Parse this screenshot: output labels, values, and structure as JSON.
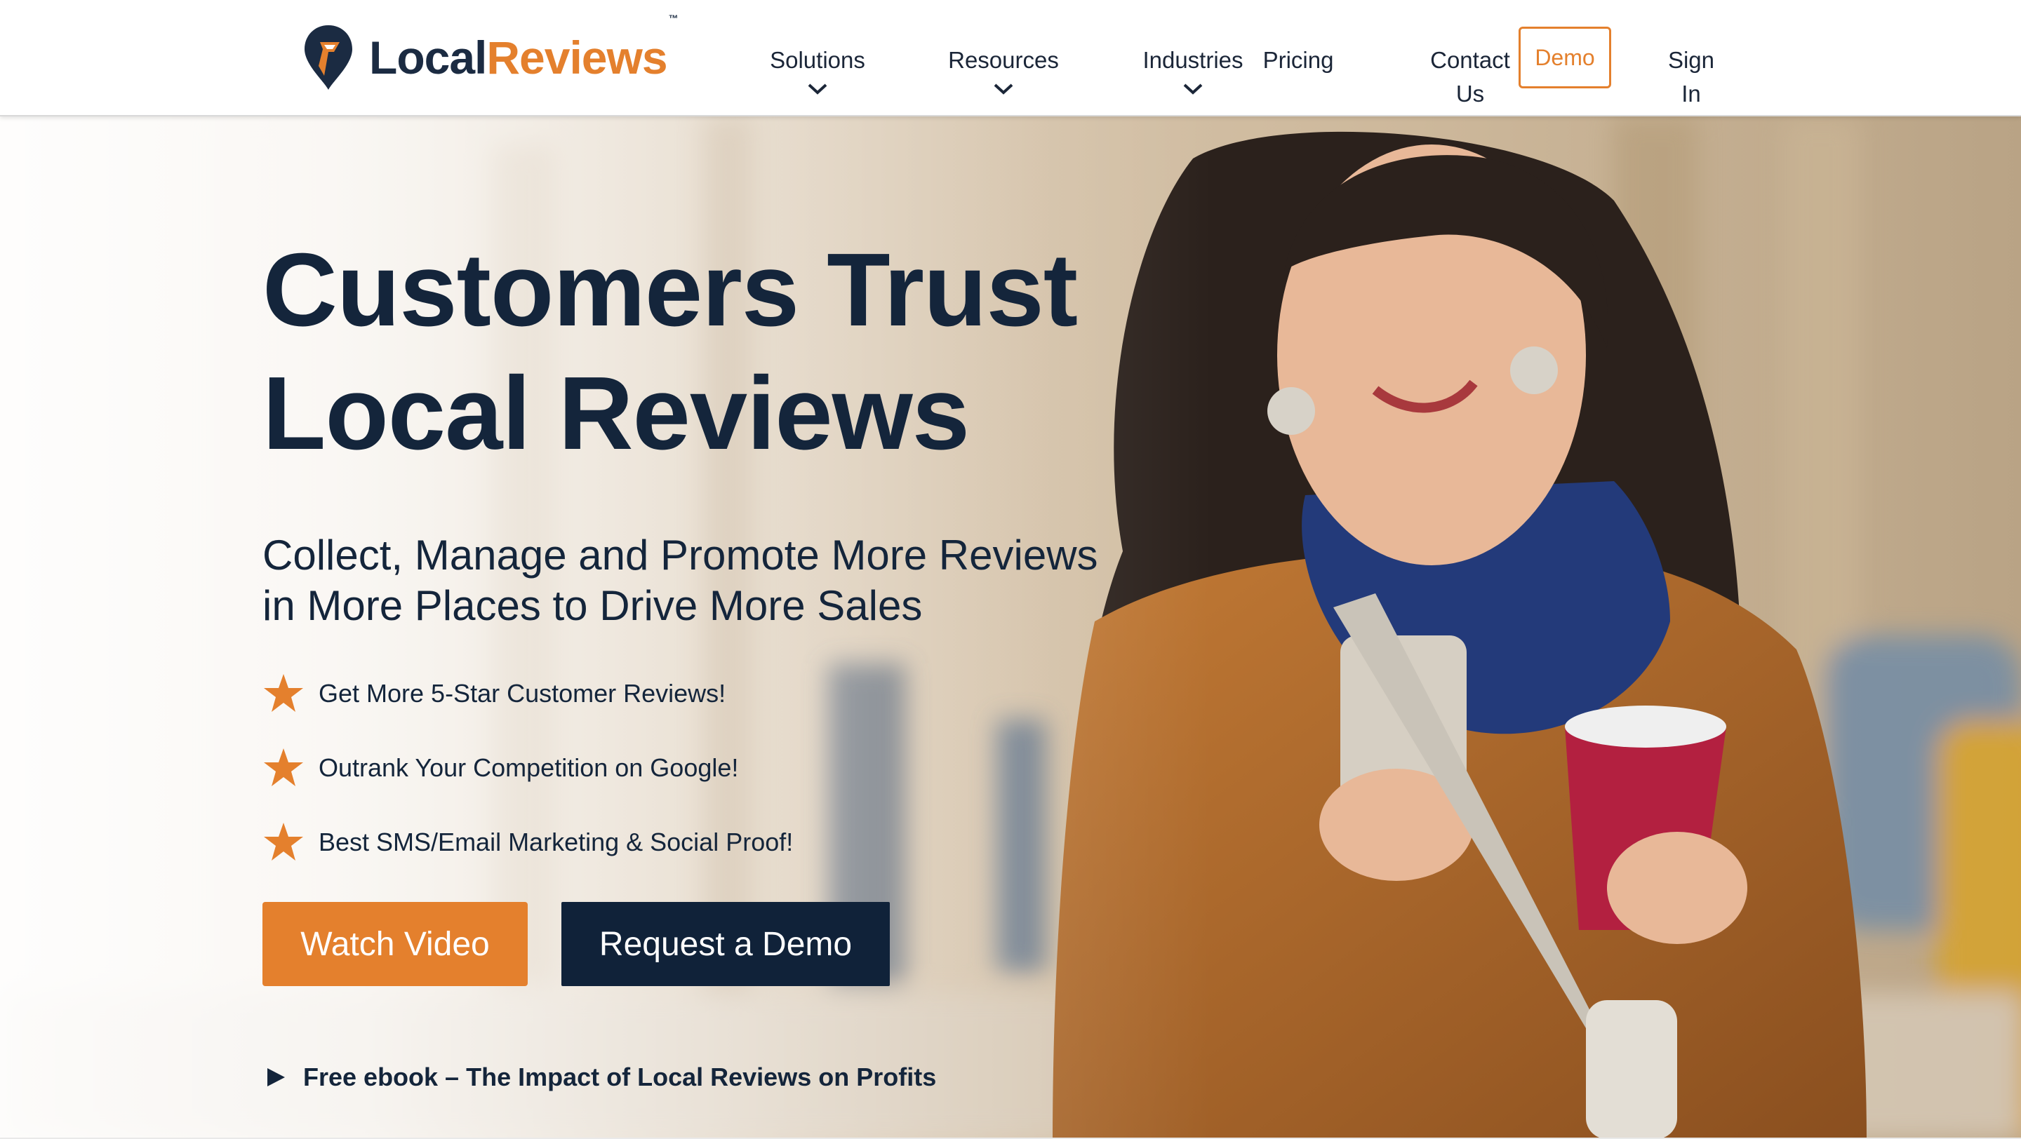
{
  "brand": {
    "name_part1": "Local",
    "name_part2": "Reviews",
    "trademark": "™",
    "colors": {
      "navy": "#14253b",
      "orange": "#e4802d"
    }
  },
  "nav": {
    "items": [
      {
        "label": "Solutions",
        "has_dropdown": true
      },
      {
        "label": "Resources",
        "has_dropdown": true
      },
      {
        "label": "Industries",
        "has_dropdown": true
      },
      {
        "label": "Pricing",
        "has_dropdown": false
      },
      {
        "label_line1": "Contact",
        "label_line2": "Us",
        "has_dropdown": false
      }
    ],
    "demo_button": "Demo",
    "sign_in_line1": "Sign",
    "sign_in_line2": "In"
  },
  "hero": {
    "headline_line1": "Customers Trust",
    "headline_line2": "Local Reviews",
    "subhead_line1": "Collect, Manage and Promote More Reviews",
    "subhead_line2": "in More Places to Drive More Sales",
    "bullets": [
      {
        "icon": "star-icon",
        "text": "Get More 5-Star Customer Reviews!"
      },
      {
        "icon": "star-icon",
        "text": "Outrank Your Competition on Google!"
      },
      {
        "icon": "star-icon",
        "text": "Best SMS/Email Marketing & Social Proof!"
      }
    ],
    "watch_video_label": "Watch Video",
    "request_demo_label": "Request a Demo",
    "ebook_icon": "play-icon",
    "ebook_label": "Free ebook – The Impact of Local Reviews on Profits"
  }
}
